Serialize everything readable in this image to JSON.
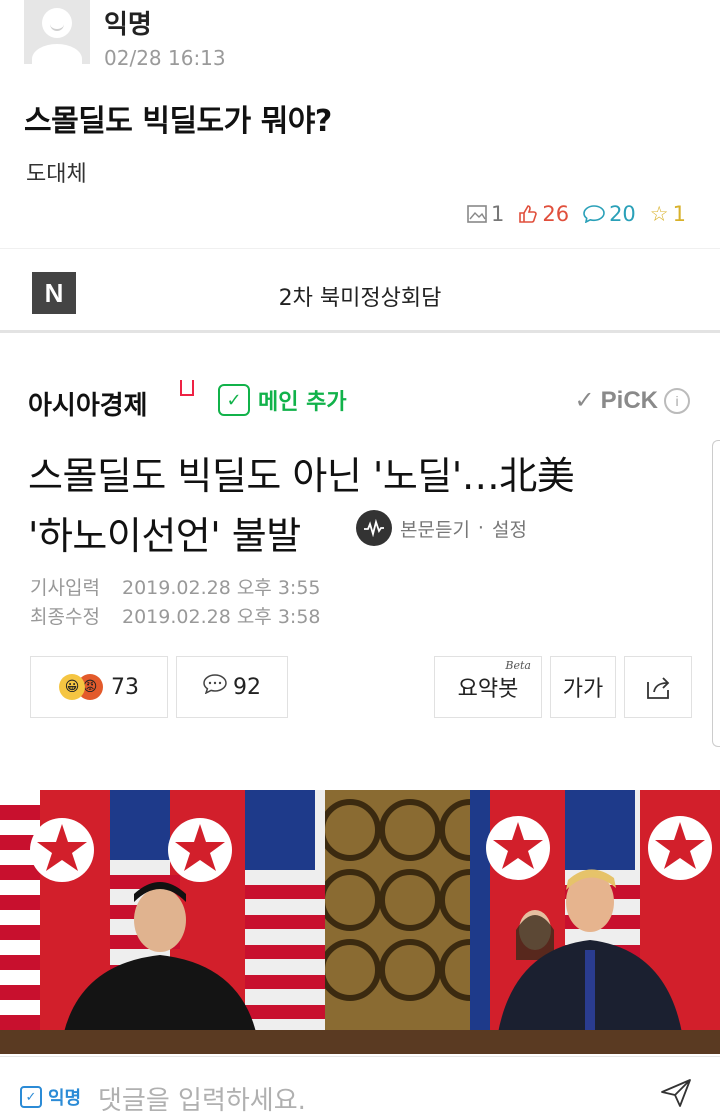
{
  "post": {
    "author": "익명",
    "time": "02/28 16:13",
    "title": "스몰딜도 빅딜도가 뭐야?",
    "body": "도대체",
    "stats": {
      "images": "1",
      "likes": "26",
      "comments": "20",
      "scraps": "1"
    }
  },
  "naver_bar": {
    "logo": "N",
    "title": "2차 북미정상회담"
  },
  "article": {
    "press": "아시아경제",
    "add_main": "메인 추가",
    "pick": "PiCK",
    "headline_line1": "스몰딜도 빅딜도 아닌 '노딜'…北美",
    "headline_line2": "'하노이선언' 불발",
    "listen": "본문듣기",
    "settings": "설정",
    "input_label": "기사입력",
    "input_time": "2019.02.28 오후 3:55",
    "modified_label": "최종수정",
    "modified_time": "2019.02.28 오후 3:58",
    "reaction_count": "73",
    "comment_count": "92",
    "summary_bot": "요약봇",
    "summary_beta": "Beta",
    "font_size": "가가"
  },
  "comment_bar": {
    "anon_label": "익명",
    "placeholder": "댓글을 입력하세요."
  },
  "colors": {
    "green": "#11b24a",
    "like_red": "#e04f3c",
    "comment_teal": "#2aa0b8",
    "scrap_yellow": "#d8b12a",
    "blue": "#2b8bd6"
  }
}
